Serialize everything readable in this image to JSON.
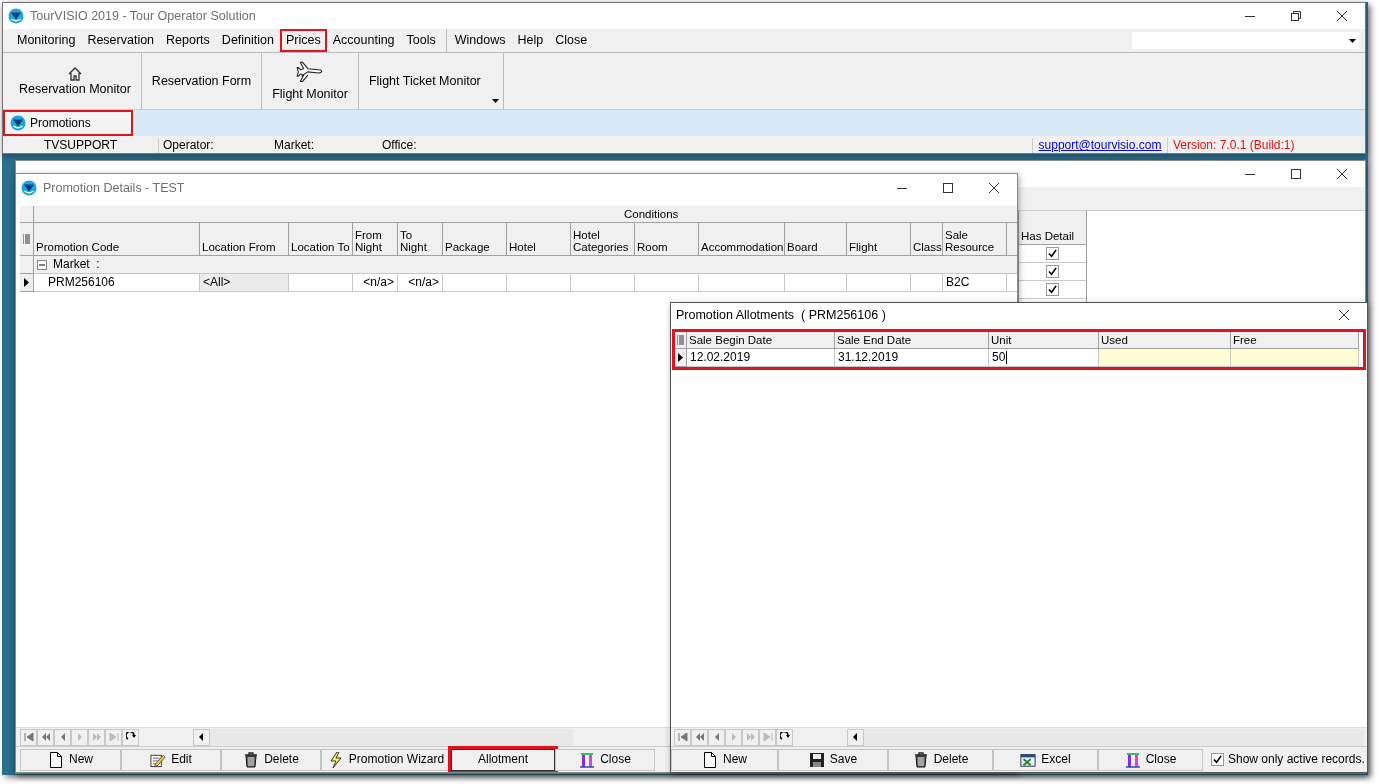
{
  "app": {
    "title": "TourVISIO 2019 - Tour Operator Solution",
    "menu_groups": [
      [
        {
          "label": "Monitoring",
          "highlighted": false
        },
        {
          "label": "Reservation",
          "highlighted": false
        },
        {
          "label": "Reports",
          "highlighted": false
        },
        {
          "label": "Definition",
          "highlighted": false
        },
        {
          "label": "Prices",
          "highlighted": true
        },
        {
          "label": "Accounting",
          "highlighted": false
        },
        {
          "label": "Tools",
          "highlighted": false
        }
      ],
      [
        {
          "label": "Windows",
          "highlighted": false
        },
        {
          "label": "Help",
          "highlighted": false
        },
        {
          "label": "Close",
          "highlighted": false
        }
      ]
    ],
    "toolbar": [
      {
        "label": "Reservation Monitor",
        "kind": "home"
      },
      {
        "label": "Reservation Form",
        "kind": "plain"
      },
      {
        "label": "Flight Monitor",
        "kind": "plane"
      },
      {
        "label": "Flight Ticket Monitor",
        "kind": "plain",
        "dropdown": true
      }
    ],
    "tabs": [
      {
        "label": "Promotions",
        "selected": true,
        "highlighted": true
      }
    ],
    "status_bar": {
      "user": "TVSUPPORT",
      "operator": "Operator:",
      "market": "Market:",
      "office": "Office:",
      "email": "support@tourvisio.com",
      "version": "Version: 7.0.1 (Build:1)"
    }
  },
  "promotions_window": {
    "has_detail": {
      "header": "Has Detail",
      "rows": [
        {
          "checked": true
        },
        {
          "checked": true
        },
        {
          "checked": true
        }
      ]
    }
  },
  "details_window": {
    "title": "Promotion Details - TEST",
    "band": "Conditions",
    "columns": [
      {
        "label": "Promotion Code",
        "kind": "text"
      },
      {
        "label": "Location From",
        "kind": "text"
      },
      {
        "label": "Location To",
        "kind": "text"
      },
      {
        "label": "From Night",
        "kind": "number"
      },
      {
        "label": "To Night",
        "kind": "number"
      },
      {
        "label": "Package",
        "kind": "text"
      },
      {
        "label": "Hotel",
        "kind": "text"
      },
      {
        "label": "Hotel Categories",
        "kind": "text"
      },
      {
        "label": "Room",
        "kind": "text"
      },
      {
        "label": "Accommodation",
        "kind": "text"
      },
      {
        "label": "Board",
        "kind": "text"
      },
      {
        "label": "Flight",
        "kind": "text"
      },
      {
        "label": "Class",
        "kind": "text"
      },
      {
        "label": "Sale Resource",
        "kind": "text"
      }
    ],
    "group": {
      "label": "Market  :",
      "expanded": true
    },
    "rows": [
      {
        "current": true,
        "cells": [
          {
            "text": "PRM256106"
          },
          {
            "text": "<All>",
            "shaded": true
          },
          {},
          {
            "text": "<n/a>"
          },
          {
            "text": "<n/a>"
          },
          {},
          {},
          {},
          {},
          {},
          {},
          {},
          {},
          {
            "text": "B2C"
          }
        ]
      }
    ],
    "buttons": [
      {
        "label": "New",
        "kind": "new",
        "highlighted": false
      },
      {
        "label": "Edit",
        "kind": "edit",
        "highlighted": false
      },
      {
        "label": "Delete",
        "kind": "delete",
        "highlighted": false
      },
      {
        "label": "Promotion Wizard",
        "kind": "wizard",
        "highlighted": false
      },
      {
        "label": "Allotment",
        "kind": "plain",
        "highlighted": true
      },
      {
        "label": "Close",
        "kind": "exit",
        "highlighted": false
      }
    ]
  },
  "allotments_window": {
    "title": "Promotion Allotments  ( PRM256106 )",
    "highlighted": true,
    "columns": [
      {
        "label": "Sale Begin Date",
        "readonly": false
      },
      {
        "label": "Sale End Date",
        "readonly": false
      },
      {
        "label": "Unit",
        "readonly": false
      },
      {
        "label": "Used",
        "readonly": true
      },
      {
        "label": "Free",
        "readonly": true
      }
    ],
    "rows": [
      {
        "current": true,
        "cells": [
          {
            "text": "12.02.2019"
          },
          {
            "text": "31.12.2019"
          },
          {
            "text": "50",
            "editing": true
          },
          {},
          {}
        ]
      }
    ],
    "buttons": [
      {
        "label": "New",
        "kind": "new"
      },
      {
        "label": "Save",
        "kind": "save"
      },
      {
        "label": "Delete",
        "kind": "delete"
      },
      {
        "label": "Excel",
        "kind": "excel"
      },
      {
        "label": "Close",
        "kind": "exit"
      }
    ],
    "active_only": {
      "label": "Show only active records.",
      "checked": true
    }
  }
}
